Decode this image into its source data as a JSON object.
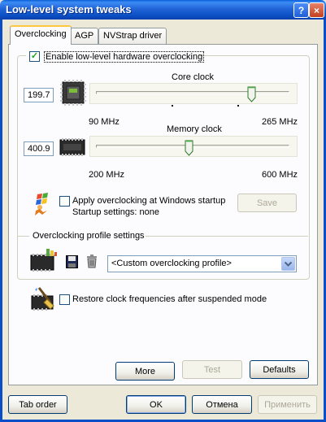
{
  "window": {
    "title": "Low-level system tweaks",
    "help_label": "?",
    "close_label": "×"
  },
  "tabs": [
    {
      "label": "Overclocking",
      "active": true
    },
    {
      "label": "AGP",
      "active": false
    },
    {
      "label": "NVStrap driver",
      "active": false
    }
  ],
  "overclocking": {
    "enable_label": "Enable low-level hardware overclocking",
    "enable_checked": true,
    "core": {
      "label": "Core clock",
      "value": "199.7",
      "min_label": "90 MHz",
      "max_label": "265 MHz",
      "position": 0.82
    },
    "memory": {
      "label": "Memory clock",
      "value": "400.9",
      "min_label": "200 MHz",
      "max_label": "600 MHz",
      "position": 0.48
    },
    "apply_startup_label": "Apply overclocking at Windows startup",
    "apply_startup_checked": false,
    "startup_settings": "Startup settings: none",
    "save_label": "Save"
  },
  "profiles": {
    "section_label": "Overclocking profile settings",
    "selected": "<Custom overclocking profile>",
    "save_icon": "floppy-disk-icon",
    "delete_icon": "trash-icon"
  },
  "restore": {
    "label": "Restore clock frequencies after suspended mode",
    "checked": false
  },
  "panel_buttons": {
    "more": "More",
    "test": "Test",
    "defaults": "Defaults"
  },
  "footer": {
    "tab_order": "Tab order",
    "ok": "OK",
    "cancel": "Отмена",
    "apply": "Применить"
  },
  "colors": {
    "titlebar": "#0a4fc4",
    "dialog_bg": "#ece9d8",
    "checkmark": "#21a121"
  }
}
